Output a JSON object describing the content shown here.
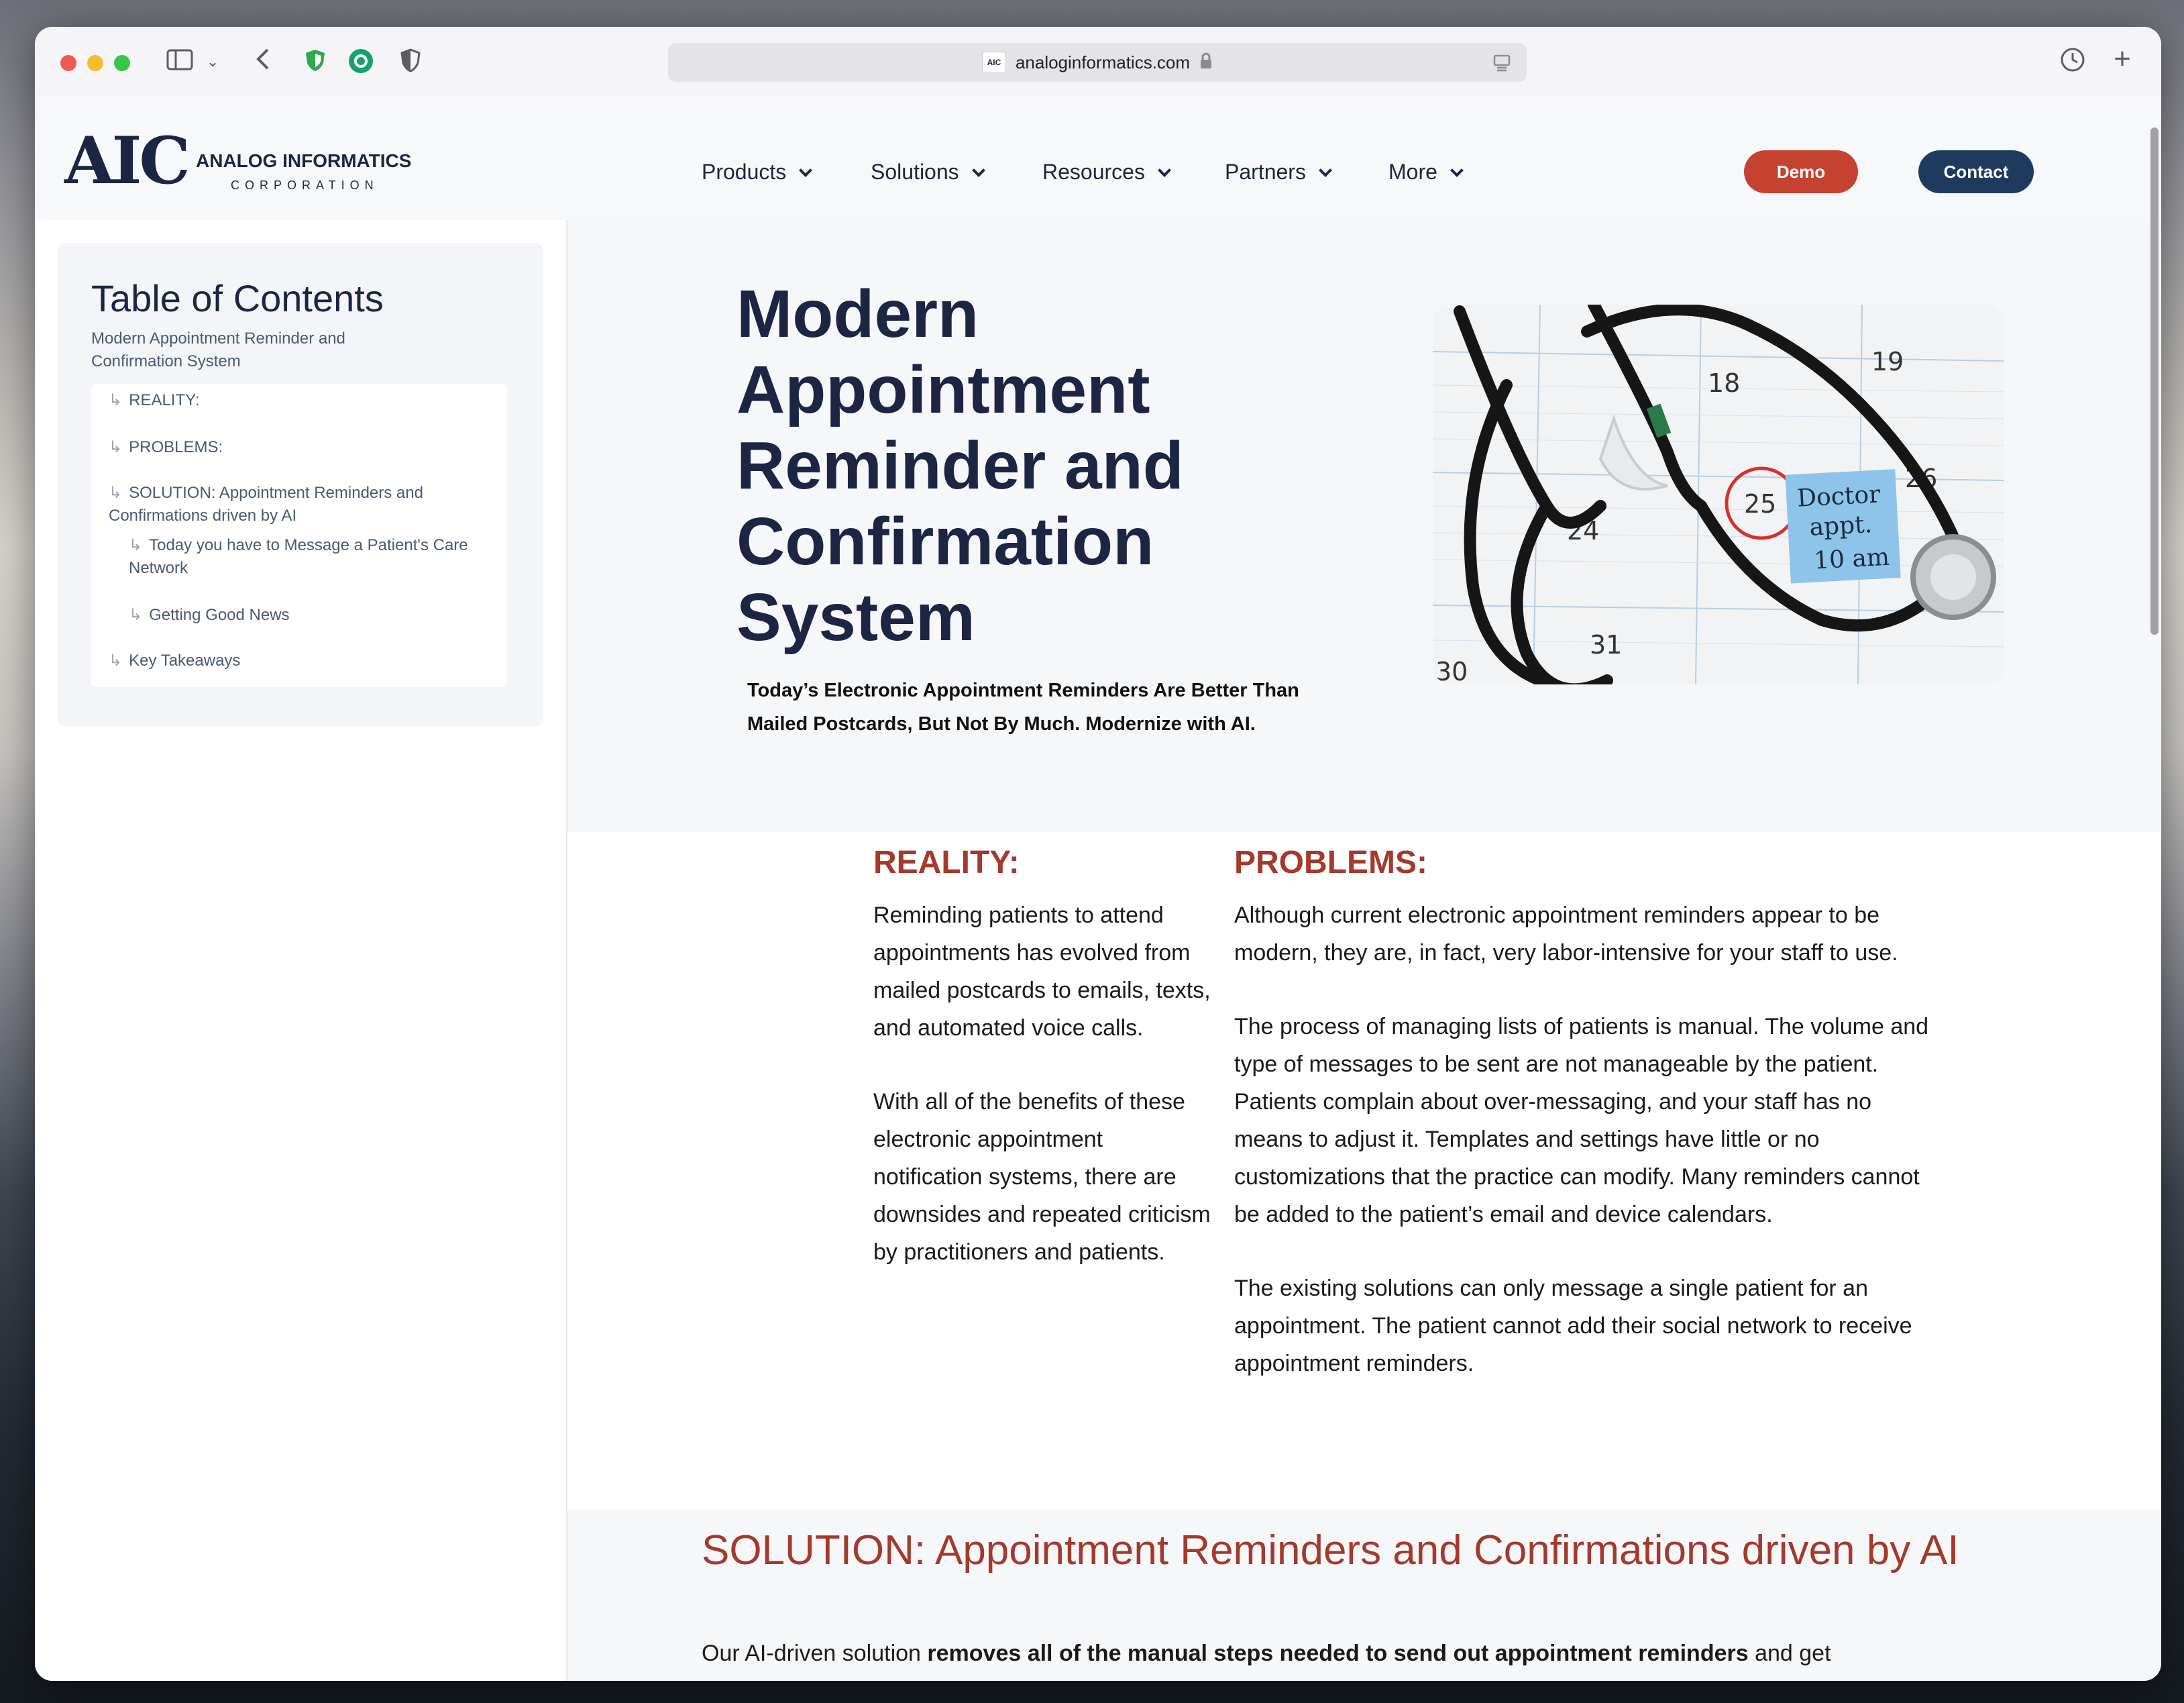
{
  "browser": {
    "url": "analoginformatics.com",
    "favicon_text": "AIC",
    "lock_icon": "lock-icon",
    "traffic_lights": {
      "close": "#ee5b55",
      "minimize": "#f5bd2e",
      "maximize": "#35c748"
    }
  },
  "header": {
    "logo_mark": "AIC",
    "logo_name": "ANALOG INFORMATICS",
    "logo_sub": "CORPORATION",
    "nav": [
      "Products",
      "Solutions",
      "Resources",
      "Partners",
      "More"
    ],
    "demo_label": "Demo",
    "contact_label": "Contact",
    "demo_color": "#c64230",
    "contact_color": "#1f3a5f"
  },
  "toc": {
    "title": "Table of Contents",
    "subtitle": "Modern Appointment Reminder and Confirmation System",
    "items": [
      "REALITY:",
      "PROBLEMS:",
      "SOLUTION: Appointment Reminders and Confirmations driven by AI",
      "Today you have to Message a Patient's Care Network",
      "Getting Good News",
      "Key Takeaways"
    ]
  },
  "hero": {
    "title": "Modern Appointment Reminder and Confirmation System",
    "tagline_line1": "Today’s Electronic Appointment Reminders Are Better Than",
    "tagline_line2": "Mailed Postcards, But Not By Much. Modernize with AI.",
    "image": {
      "calendar_numbers": [
        "18",
        "19",
        "24",
        "25",
        "26",
        "30",
        "31"
      ],
      "note_line1": "Doctor",
      "note_line2": "appt.",
      "note_line3": "10 am"
    }
  },
  "reality": {
    "heading": "REALITY:",
    "p1": "Reminding patients to attend appointments has evolved from mailed postcards to emails, texts, and automated voice calls.",
    "p2": "With all of the benefits of these electronic appointment notification systems, there are downsides and repeated criticism by practitioners and patients."
  },
  "problems": {
    "heading": "PROBLEMS:",
    "p1": "Although current electronic appointment reminders appear to be modern, they are, in fact, very labor-intensive for your staff to use.",
    "p2": "The process of managing lists of patients is manual. The volume and type of messages to be sent are not manageable by the patient. Patients complain about over-messaging, and your staff has no means to adjust it. Templates and settings have little or no customizations that the practice can modify. Many reminders cannot be added to the patient’s email and device calendars.",
    "p3": "The existing solutions can only message a single patient for an appointment. The patient cannot add their social network to receive appointment reminders."
  },
  "solution": {
    "heading": "SOLUTION: Appointment Reminders and Confirmations driven by AI",
    "text_start": "Our AI-driven solution ",
    "text_bold": "removes all of the manual steps needed to send out appointment reminders",
    "text_end": " and get"
  }
}
